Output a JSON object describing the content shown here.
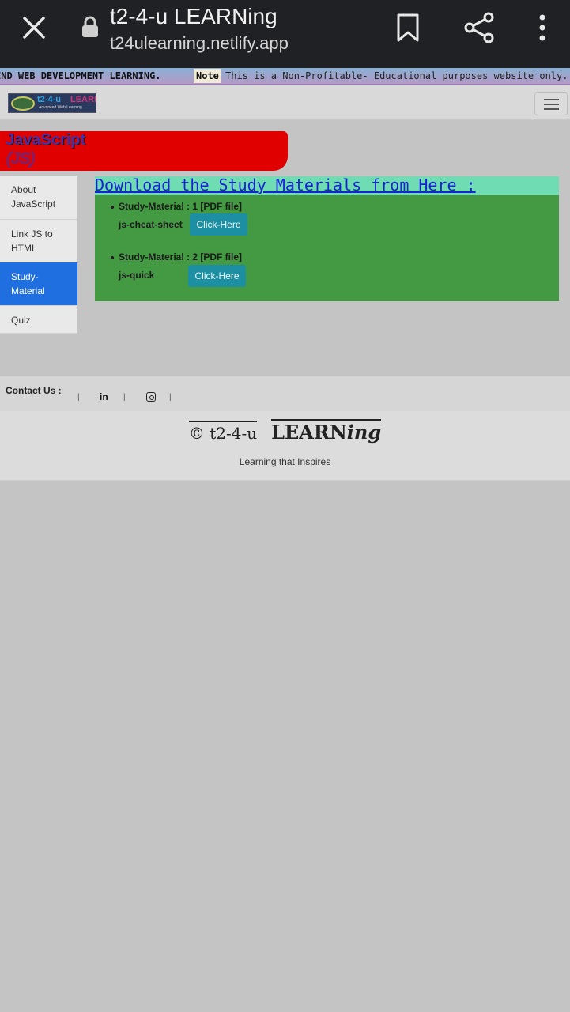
{
  "browser": {
    "title": "t2-4-u LEARNing",
    "url": "t24ulearning.netlify.app"
  },
  "marquee": {
    "text_left": "END WEB DEVELOPMENT LEARNING.",
    "note_label": "Note",
    "text_right": "This is a Non-Profitable- Educational purposes website only."
  },
  "navbar": {
    "logo_text_a": "t2-4-u",
    "logo_text_b": "LEARNing",
    "logo_tagline": "Advanced Web Learning"
  },
  "banner": {
    "title": "JavaScript",
    "subtitle": "(JS)"
  },
  "sidebar": {
    "items": [
      {
        "label": "About JavaScript"
      },
      {
        "label": "Link JS to HTML"
      },
      {
        "label": "Study-Material"
      },
      {
        "label": "Quiz"
      }
    ]
  },
  "main": {
    "download_heading": "Download the Study Materials from Here :",
    "materials": [
      {
        "title": "Study-Material : 1 [PDF file]",
        "name": "js-cheat-sheet",
        "button": "Click-Here"
      },
      {
        "title": "Study-Material : 2 [PDF file]",
        "name": "js-quick",
        "button": "Click-Here"
      }
    ]
  },
  "contact": {
    "label": "Contact Us :",
    "linkedin_icon_text": "in"
  },
  "footer": {
    "copyright": "© t2-4-u",
    "brand_main": "LEARN",
    "brand_suffix": "ing",
    "tagline": "Learning that Inspires"
  },
  "colors": {
    "active_sidebar": "#1f6fe0",
    "banner_red": "#e00000",
    "content_green": "#449943",
    "heading_band": "#6fdcb4",
    "button_teal": "#1c8fa3"
  }
}
